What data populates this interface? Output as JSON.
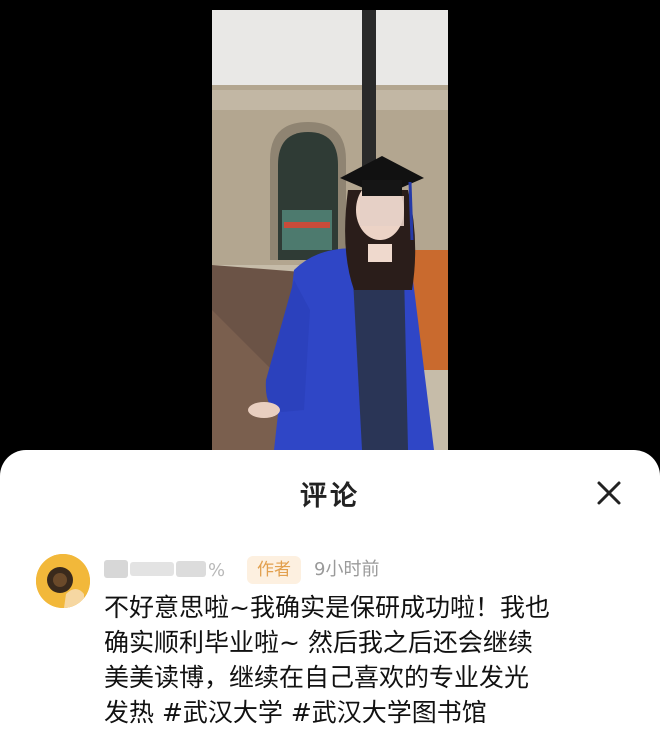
{
  "panel": {
    "title": "评论",
    "close_icon": "close-icon"
  },
  "comment": {
    "username": "•••••••• %",
    "badge": "作者",
    "time": "9小时前",
    "lines": [
      "不好意思啦~我确实是保研成功啦！我也",
      "确实顺利毕业啦~ 然后我之后还会继续",
      "美美读博，继续在自己喜欢的专业发光",
      "发热 #武汉大学 #武汉大学图书馆"
    ]
  },
  "colors": {
    "gown": "#2f46c6",
    "badge_bg": "#fdf0e0",
    "badge_text": "#e2a04e",
    "avatar_bg": "#f2b83a"
  }
}
